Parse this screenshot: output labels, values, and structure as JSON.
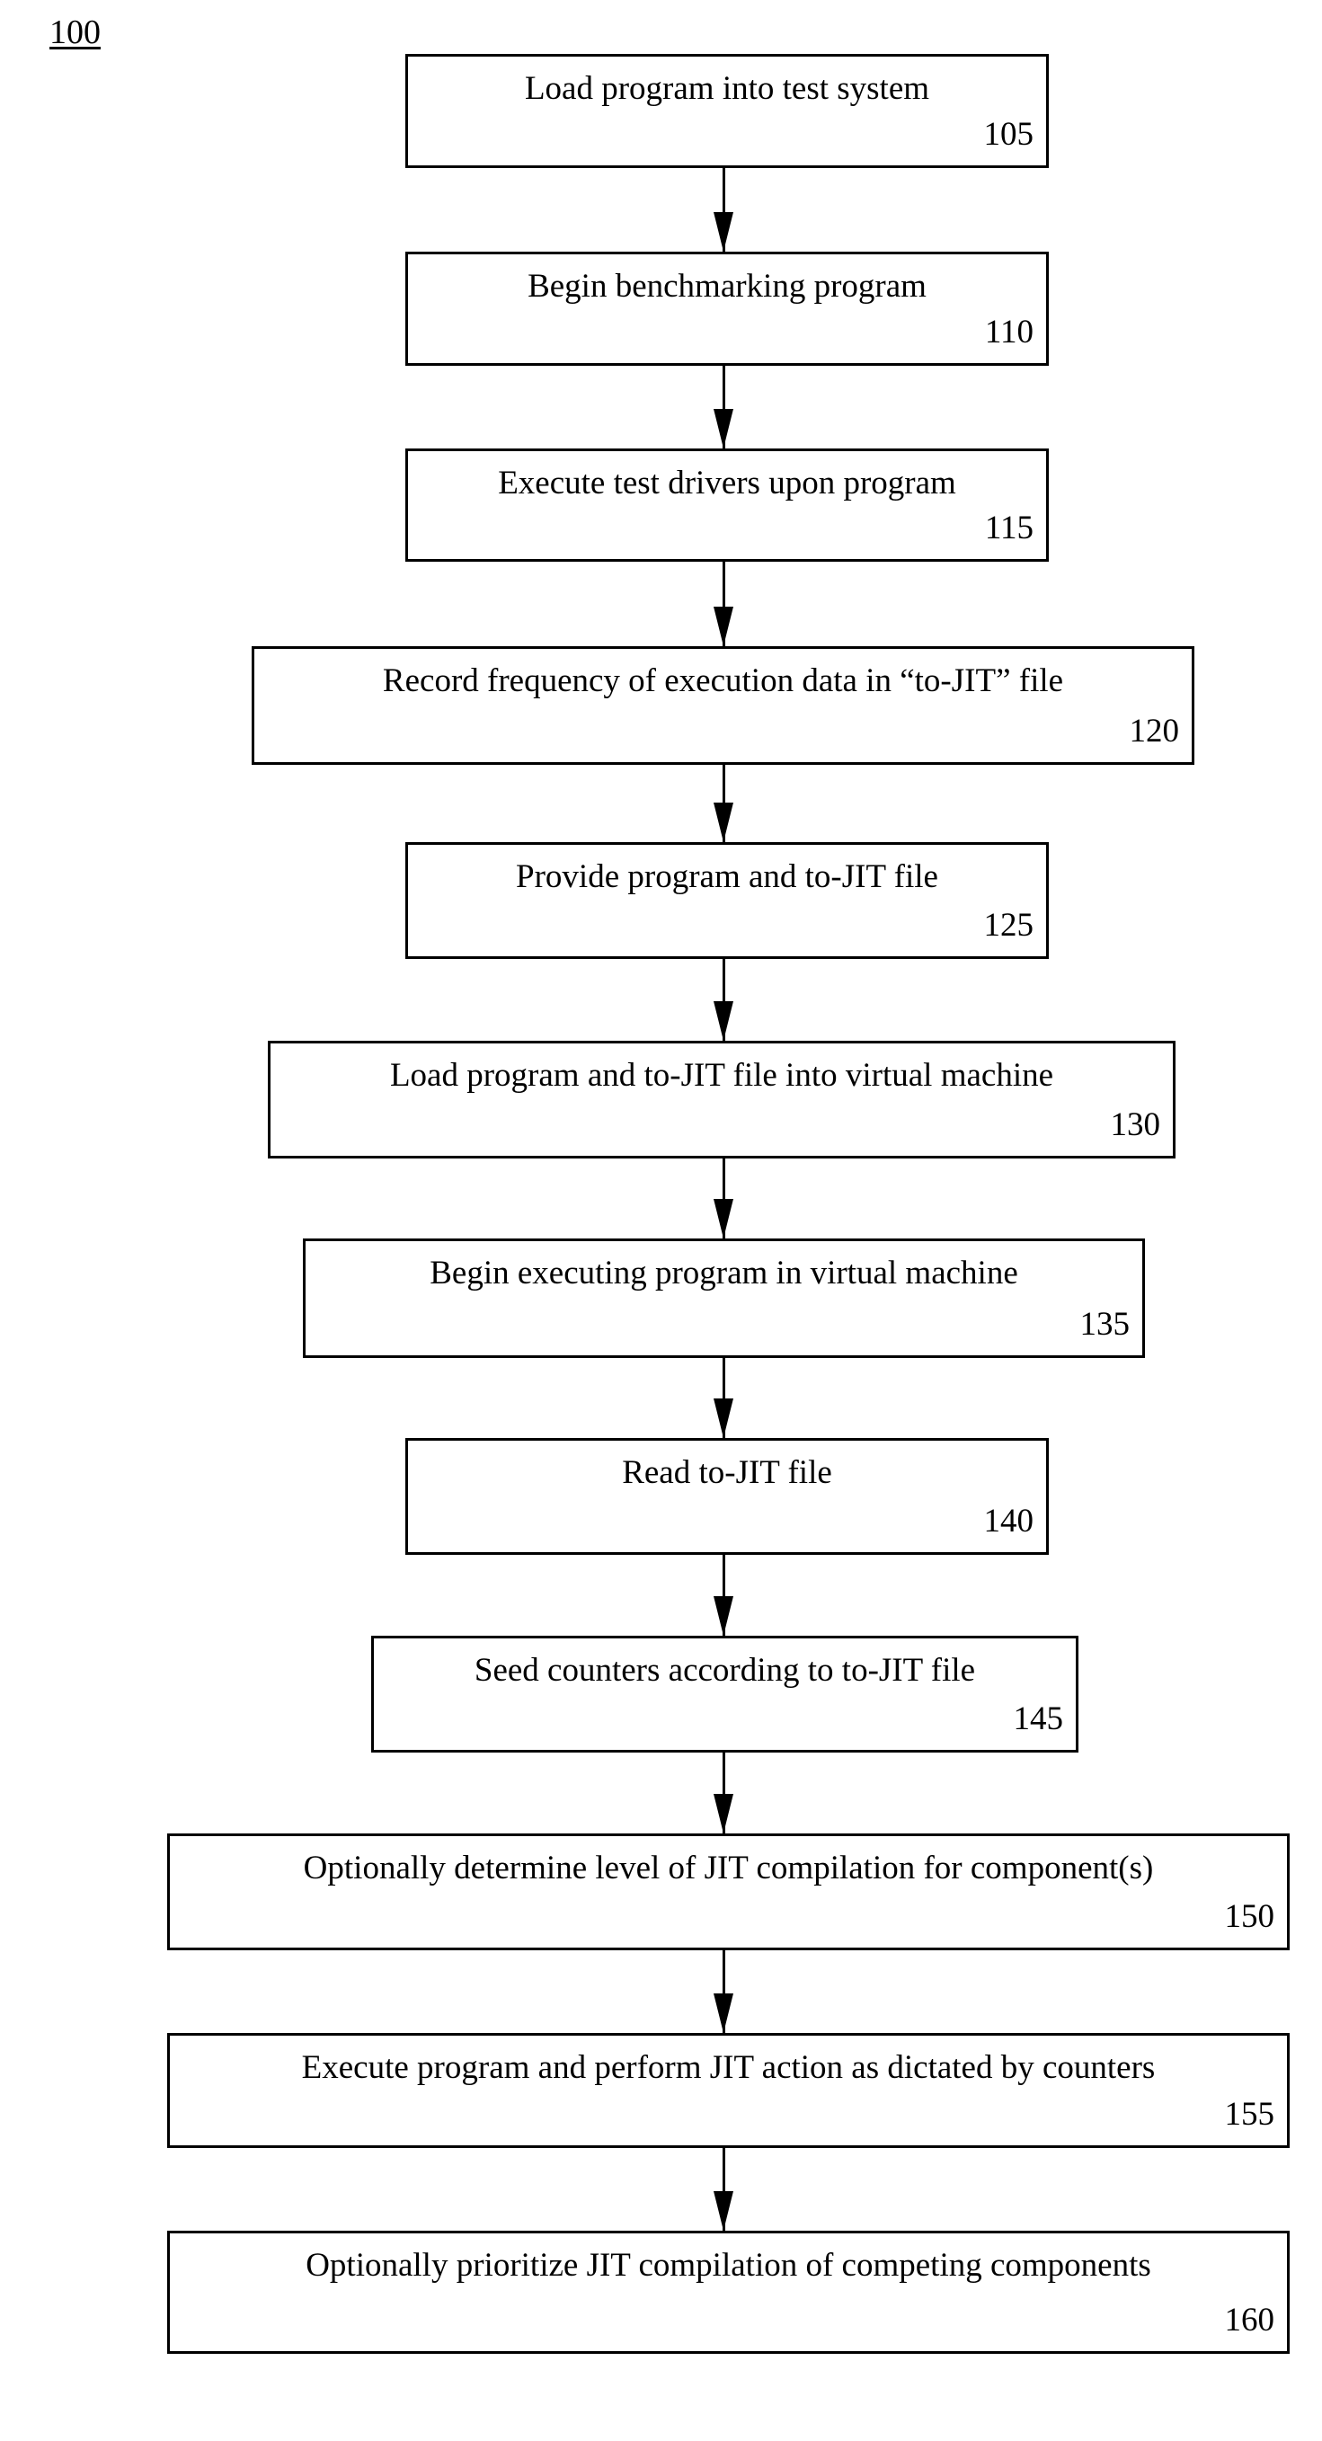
{
  "figure": {
    "number": "100"
  },
  "steps": [
    {
      "label": "Load program into test system",
      "ref": "105"
    },
    {
      "label": "Begin benchmarking program",
      "ref": "110"
    },
    {
      "label": "Execute test drivers upon program",
      "ref": "115"
    },
    {
      "label": "Record frequency of execution data in “to-JIT” file",
      "ref": "120"
    },
    {
      "label": "Provide program and to-JIT file",
      "ref": "125"
    },
    {
      "label": "Load program and to-JIT file into virtual machine",
      "ref": "130"
    },
    {
      "label": "Begin executing program in virtual machine",
      "ref": "135"
    },
    {
      "label": "Read to-JIT file",
      "ref": "140"
    },
    {
      "label": "Seed counters according to to-JIT file",
      "ref": "145"
    },
    {
      "label": "Optionally determine level of JIT compilation for component(s)",
      "ref": "150"
    },
    {
      "label": "Execute program and perform JIT action as dictated by counters",
      "ref": "155"
    },
    {
      "label": "Optionally prioritize JIT compilation of competing components",
      "ref": "160"
    }
  ]
}
